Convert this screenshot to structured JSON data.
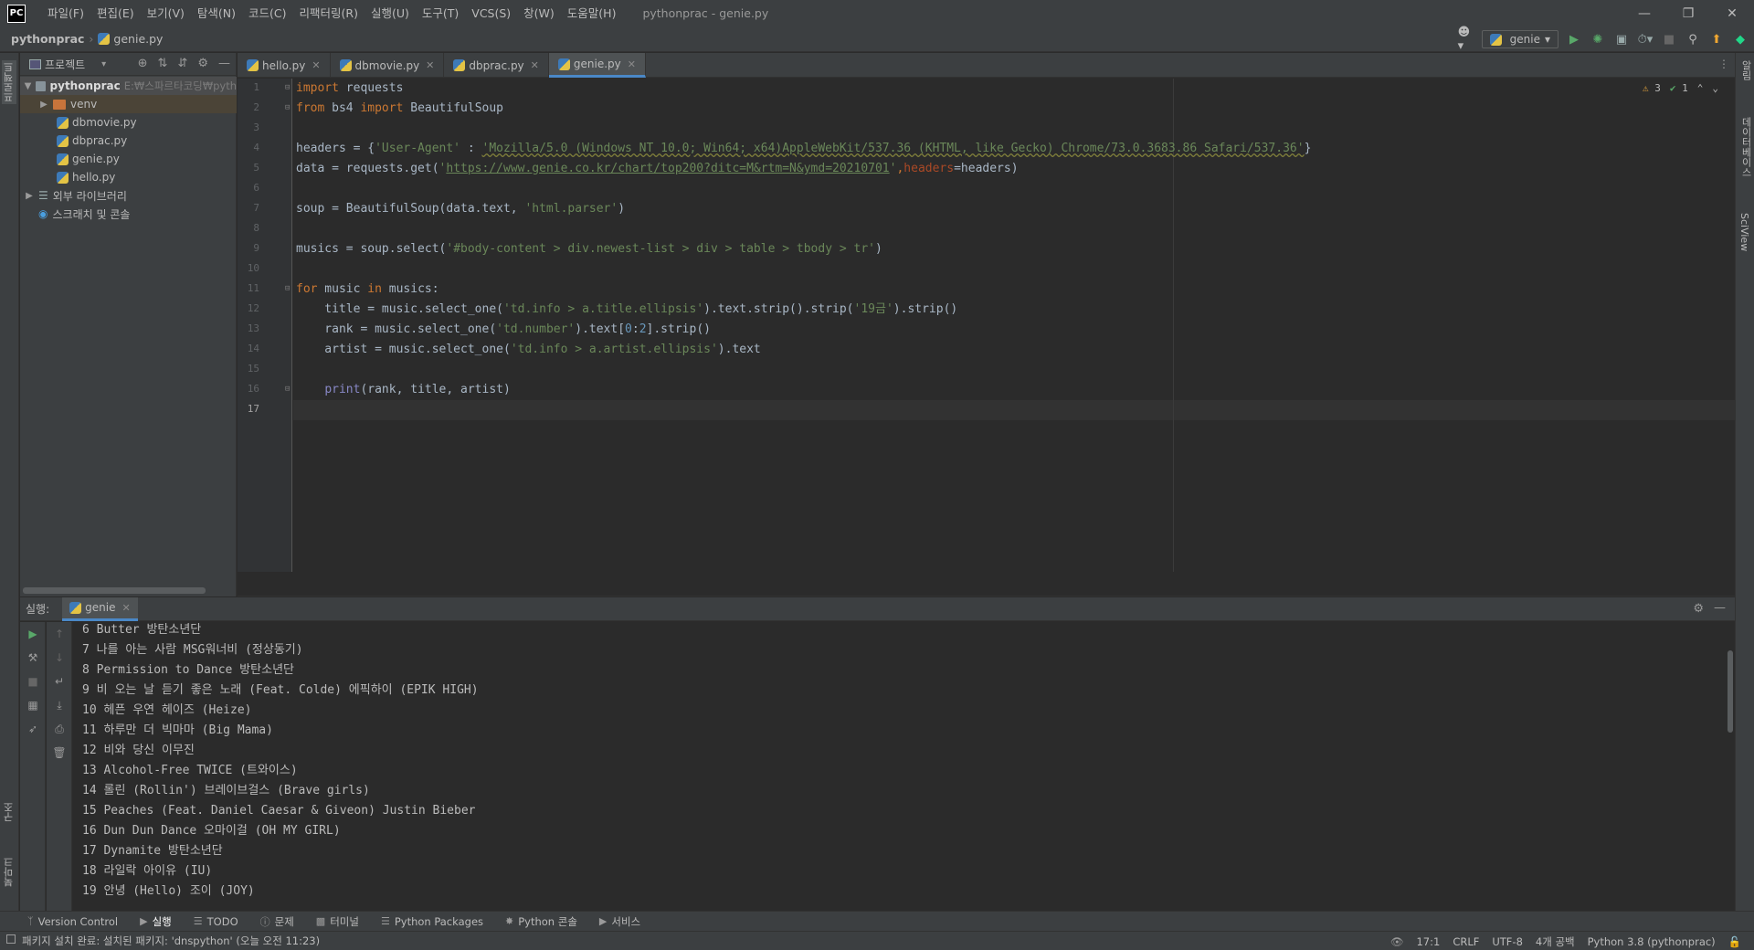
{
  "app": {
    "logo": "PC",
    "window_title": "pythonprac - genie.py",
    "menu": [
      "파일(F)",
      "편집(E)",
      "보기(V)",
      "탐색(N)",
      "코드(C)",
      "리팩터링(R)",
      "실행(U)",
      "도구(T)",
      "VCS(S)",
      "창(W)",
      "도움말(H)"
    ]
  },
  "breadcrumb": {
    "project": "pythonprac",
    "file": "genie.py"
  },
  "run_config": "genie",
  "left_strip": {
    "project_tab": "프로젝트",
    "structure_tab": "구조",
    "bookmarks_tab": "북마크"
  },
  "right_strip": {
    "notifications_tab": "알림",
    "database_tab": "데이터베이스",
    "sciview_tab": "SciView"
  },
  "project_panel": {
    "title": "프로젝트",
    "root_name": "pythonprac",
    "root_path": "E:₩스파르타코딩₩pyth",
    "items": [
      "venv",
      "dbmovie.py",
      "dbprac.py",
      "genie.py",
      "hello.py"
    ],
    "external_libs": "외부 라이브러리",
    "scratches": "스크래치 및 콘솔"
  },
  "editor": {
    "tabs": [
      "hello.py",
      "dbmovie.py",
      "dbprac.py",
      "genie.py"
    ],
    "active_tab": "genie.py",
    "line_numbers": [
      "1",
      "2",
      "3",
      "4",
      "5",
      "6",
      "7",
      "8",
      "9",
      "10",
      "11",
      "12",
      "13",
      "14",
      "15",
      "16",
      "17"
    ],
    "inspections": {
      "warnings": "3",
      "ok": "1"
    },
    "code": {
      "l1_kw": "import",
      "l1_rest": " requests",
      "l2_kw1": "from",
      "l2_mod": " bs4 ",
      "l2_kw2": "import",
      "l2_rest": " BeautifulSoup",
      "l4_a": "headers = {",
      "l4_key": "'User-Agent'",
      "l4_b": " : ",
      "l4_val": "'Mozilla/5.0 (Windows NT 10.0; Win64; x64)AppleWebKit/537.36 (KHTML, like Gecko) Chrome/73.0.3683.86 Safari/537.36'",
      "l4_c": "}",
      "l5_a": "data = requests.get(",
      "l5_url_q1": "'",
      "l5_url": "https://www.genie.co.kr/chart/top200?ditc=M&rtm=N&ymd=20210701",
      "l5_url_q2": "'",
      "l5_b": ",",
      "l5_prm": "headers",
      "l5_c": "=headers)",
      "l7_a": "soup = BeautifulSoup(data.text, ",
      "l7_str": "'html.parser'",
      "l7_b": ")",
      "l9_a": "musics = soup.select(",
      "l9_str": "'#body-content > div.newest-list > div > table > tbody > tr'",
      "l9_b": ")",
      "l11_kw1": "for",
      "l11_a": " music ",
      "l11_kw2": "in",
      "l11_b": " musics:",
      "l12_a": "    title = music.select_one(",
      "l12_str": "'td.info > a.title.ellipsis'",
      "l12_b": ").text.strip().strip(",
      "l12_str2": "'19금'",
      "l12_c": ").strip()",
      "l13_a": "    rank = music.select_one(",
      "l13_str": "'td.number'",
      "l13_b": ").text[",
      "l13_n1": "0",
      "l13_colon": ":",
      "l13_n2": "2",
      "l13_c": "].strip()",
      "l14_a": "    artist = music.select_one(",
      "l14_str": "'td.info > a.artist.ellipsis'",
      "l14_b": ").text",
      "l16_a": "    ",
      "l16_fn": "print",
      "l16_b": "(rank, title, artist)"
    }
  },
  "run_panel": {
    "label": "실행:",
    "tab": "genie",
    "output": [
      "6 Butter 방탄소년단",
      "7 나를 아는 사람 MSG워너비 (정상동기)",
      "8 Permission to Dance 방탄소년단",
      "9 비 오는 날 듣기 좋은 노래 (Feat. Colde) 에픽하이 (EPIK HIGH)",
      "10 헤픈 우연 헤이즈 (Heize)",
      "11 하루만 더 빅마마 (Big Mama)",
      "12 비와 당신 이무진",
      "13 Alcohol-Free TWICE (트와이스)",
      "14 롤린 (Rollin') 브레이브걸스 (Brave girls)",
      "15 Peaches (Feat. Daniel Caesar & Giveon) Justin Bieber",
      "16 Dun Dun Dance 오마이걸 (OH MY GIRL)",
      "17 Dynamite 방탄소년단",
      "18 라일락 아이유 (IU)",
      "19 안녕 (Hello) 조이 (JOY)"
    ]
  },
  "bottom_tabs": [
    "Version Control",
    "실행",
    "TODO",
    "문제",
    "터미널",
    "Python Packages",
    "Python 콘솔",
    "서비스"
  ],
  "status": {
    "message": "패키지 설치 완료: 설치된 패키지: 'dnspython' (오늘 오전 11:23)",
    "position": "17:1",
    "line_sep": "CRLF",
    "encoding": "UTF-8",
    "indent": "4개 공백",
    "interpreter": "Python 3.8 (pythonprac)"
  },
  "colors": {
    "accent": "#4a88c7",
    "keyword": "#cc7832",
    "string": "#6a8759",
    "run_green": "#59a869"
  }
}
